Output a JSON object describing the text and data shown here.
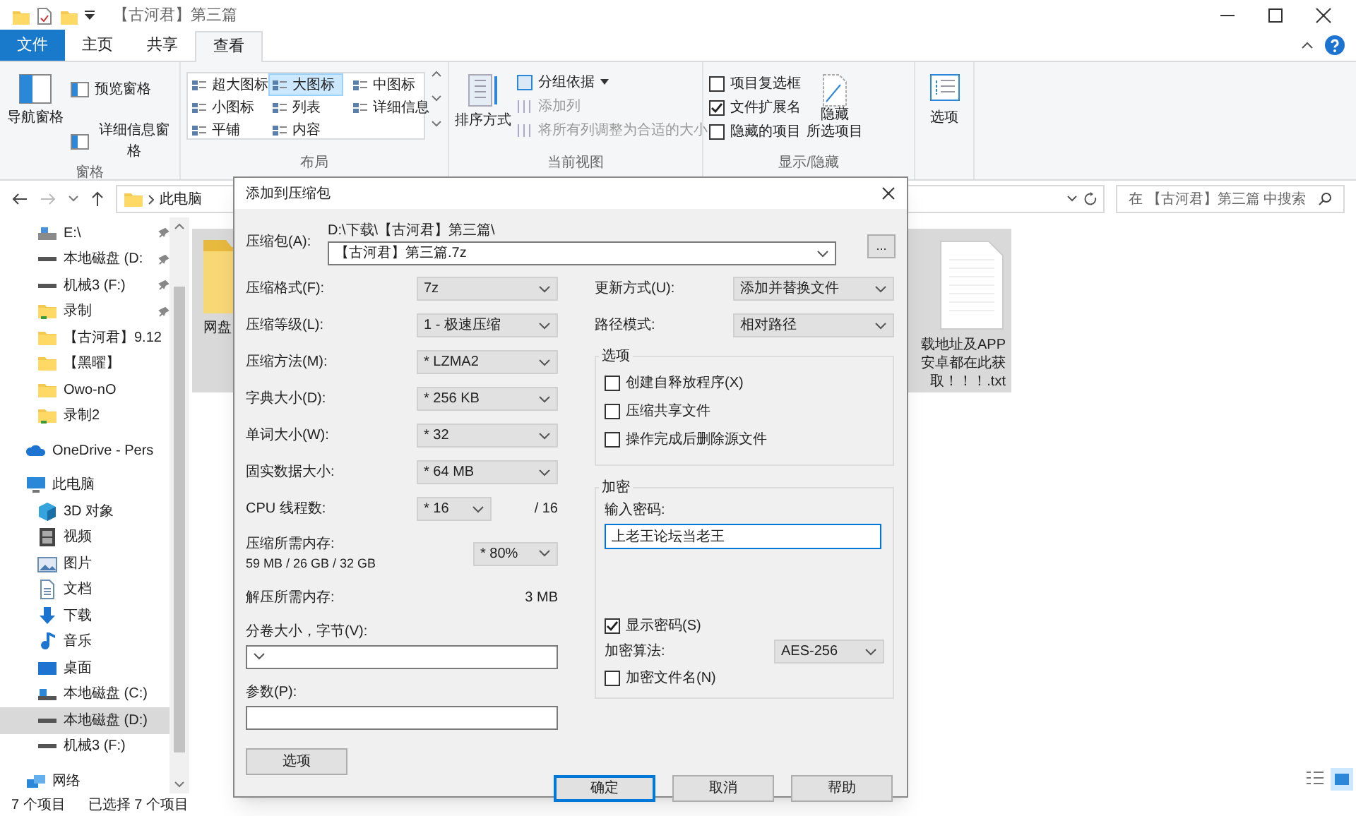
{
  "window": {
    "title": "【古河君】第三篇"
  },
  "ribbon_tabs": [
    {
      "label": "文件",
      "selected": false,
      "kind": "file"
    },
    {
      "label": "主页",
      "selected": false
    },
    {
      "label": "共享",
      "selected": false
    },
    {
      "label": "查看",
      "selected": true
    }
  ],
  "ribbon": {
    "panes": {
      "label": "窗格",
      "navigation": "导航窗格",
      "preview": "预览窗格",
      "details": "详细信息窗格"
    },
    "layout": {
      "label": "布局",
      "options": [
        {
          "label": "超大图标",
          "selected": false
        },
        {
          "label": "大图标",
          "selected": true
        },
        {
          "label": "中图标",
          "selected": false
        },
        {
          "label": "小图标",
          "selected": false
        },
        {
          "label": "列表",
          "selected": false
        },
        {
          "label": "详细信息",
          "selected": false
        },
        {
          "label": "平铺",
          "selected": false
        },
        {
          "label": "内容",
          "selected": false
        }
      ]
    },
    "current_view": {
      "label": "当前视图",
      "sort": "排序方式",
      "group_by": "分组依据",
      "add_column": "添加列",
      "fit_columns": "将所有列调整为合适的大小"
    },
    "show_hide": {
      "label": "显示/隐藏",
      "checkboxes": [
        {
          "label": "项目复选框",
          "checked": false
        },
        {
          "label": "文件扩展名",
          "checked": true
        },
        {
          "label": "隐藏的项目",
          "checked": false
        }
      ],
      "hide_selected": [
        "隐藏",
        "所选项目"
      ]
    },
    "options": "选项"
  },
  "address": {
    "crumb": "此电脑"
  },
  "search": {
    "placeholder": "在 【古河君】第三篇 中搜索"
  },
  "nav": [
    {
      "label": "E:\\",
      "kind": "usb",
      "pinned": true,
      "selected": false
    },
    {
      "label": "本地磁盘 (D:",
      "kind": "drive",
      "pinned": true,
      "selected": false
    },
    {
      "label": "机械3 (F:)",
      "kind": "drive",
      "pinned": true,
      "selected": false
    },
    {
      "label": "录制",
      "kind": "folder-green",
      "pinned": true,
      "selected": false
    },
    {
      "label": "【古河君】9.12",
      "kind": "folder",
      "pinned": false,
      "selected": false
    },
    {
      "label": "【黑曜】",
      "kind": "folder",
      "pinned": false,
      "selected": false
    },
    {
      "label": "Owo-nO",
      "kind": "folder",
      "pinned": false,
      "selected": false
    },
    {
      "label": "录制2",
      "kind": "folder-green",
      "pinned": false,
      "selected": false
    },
    {
      "label": "OneDrive - Pers",
      "kind": "cloud",
      "pinned": false,
      "selected": false,
      "root": true
    },
    {
      "label": "此电脑",
      "kind": "pc",
      "pinned": false,
      "selected": false,
      "root": true,
      "children": [
        {
          "label": "3D 对象",
          "kind": "cube",
          "pinned": false,
          "selected": false
        },
        {
          "label": "视频",
          "kind": "video",
          "pinned": false,
          "selected": false
        },
        {
          "label": "图片",
          "kind": "image",
          "pinned": false,
          "selected": false
        },
        {
          "label": "文档",
          "kind": "doc",
          "pinned": false,
          "selected": false
        },
        {
          "label": "下载",
          "kind": "download",
          "pinned": false,
          "selected": false
        },
        {
          "label": "音乐",
          "kind": "music",
          "pinned": false,
          "selected": false
        },
        {
          "label": "桌面",
          "kind": "desktop",
          "pinned": false,
          "selected": false
        },
        {
          "label": "本地磁盘 (C:)",
          "kind": "system-drive",
          "pinned": false,
          "selected": false
        },
        {
          "label": "本地磁盘 (D:)",
          "kind": "drive",
          "pinned": false,
          "selected": true
        },
        {
          "label": "机械3 (F:)",
          "kind": "drive",
          "pinned": false,
          "selected": false
        }
      ]
    },
    {
      "label": "网络",
      "kind": "network",
      "pinned": false,
      "selected": false,
      "root": true
    }
  ],
  "files": [
    {
      "kind": "folder",
      "selected": true,
      "name": [
        "网盘"
      ]
    },
    {
      "kind": "text",
      "selected": true,
      "name": [
        "载地址及APP",
        "安卓都在此获",
        "取！！！.txt"
      ]
    }
  ],
  "status_bar": {
    "count": "7 个项目",
    "selected": "已选择 7 个项目"
  },
  "dialog": {
    "title": "添加到压缩包",
    "archive": {
      "label": "压缩包(A):",
      "path": "D:\\下载\\【古河君】第三篇\\",
      "value": "【古河君】第三篇.7z",
      "browse": "..."
    },
    "left_fields": [
      {
        "label": "压缩格式(F):",
        "value": "7z"
      },
      {
        "label": "压缩等级(L):",
        "value": "1 - 极速压缩"
      },
      {
        "label": "压缩方法(M):",
        "value": "* LZMA2"
      },
      {
        "label": "字典大小(D):",
        "value": "* 256 KB"
      },
      {
        "label": "单词大小(W):",
        "value": "* 32"
      },
      {
        "label": "固实数据大小:",
        "value": "* 64 MB"
      }
    ],
    "cpu": {
      "label": "CPU 线程数:",
      "value": "* 16",
      "total": "/ 16"
    },
    "memory": {
      "label": "压缩所需内存:",
      "detail": "59 MB / 26 GB / 32 GB",
      "value": "* 80%"
    },
    "decompress": {
      "label": "解压所需内存:",
      "value": "3 MB"
    },
    "volume": {
      "label": "分卷大小，字节(V):"
    },
    "params": {
      "label": "参数(P):"
    },
    "options_button": "选项",
    "right_fields": [
      {
        "label": "更新方式(U):",
        "value": "添加并替换文件"
      },
      {
        "label": "路径模式:",
        "value": "相对路径"
      }
    ],
    "options_group": {
      "title": "选项",
      "checkboxes": [
        {
          "label": "创建自释放程序(X)",
          "checked": false
        },
        {
          "label": "压缩共享文件",
          "checked": false
        },
        {
          "label": "操作完成后删除源文件",
          "checked": false
        }
      ]
    },
    "encryption": {
      "title": "加密",
      "password_label": "输入密码:",
      "password": "上老王论坛当老王",
      "show_password": {
        "label": "显示密码(S)",
        "checked": true
      },
      "method_label": "加密算法:",
      "method": "AES-256",
      "encrypt_names": {
        "label": "加密文件名(N)",
        "checked": false
      }
    },
    "buttons": [
      {
        "label": "确定",
        "focused": true
      },
      {
        "label": "取消",
        "focused": false
      },
      {
        "label": "帮助",
        "focused": false
      }
    ]
  }
}
